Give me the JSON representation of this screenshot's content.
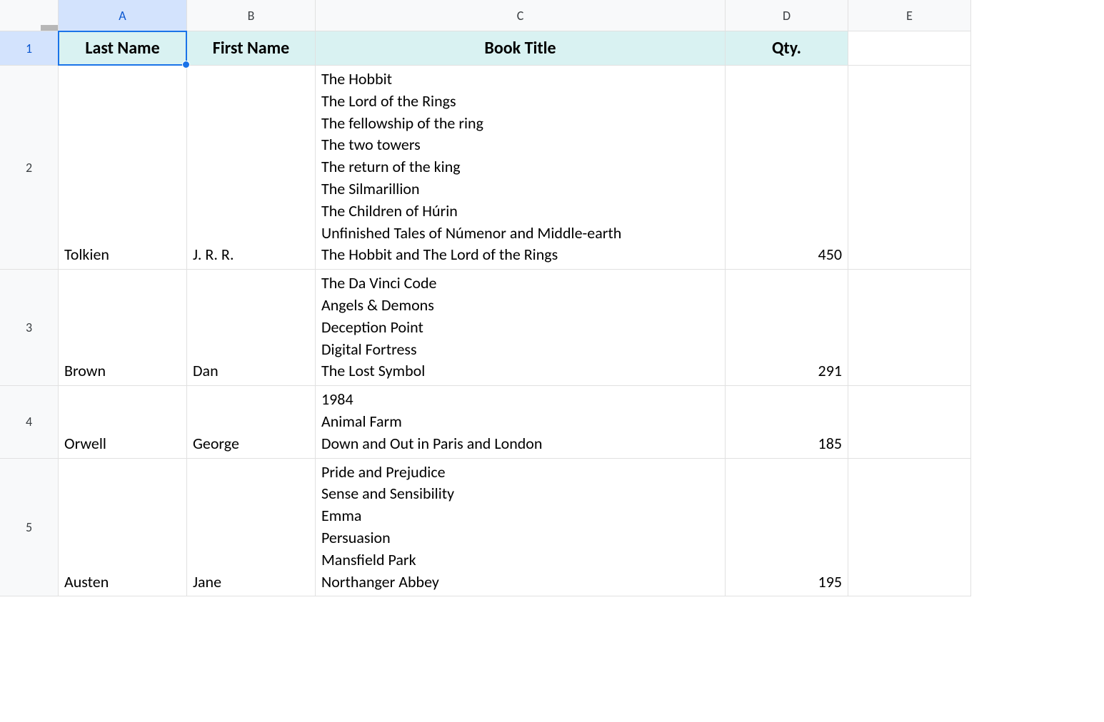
{
  "columns": [
    "A",
    "B",
    "C",
    "D",
    "E"
  ],
  "headers": {
    "last_name": "Last Name",
    "first_name": "First Name",
    "book_title": "Book Title",
    "qty": "Qty."
  },
  "rows": [
    {
      "num": "1"
    },
    {
      "num": "2",
      "last_name": "Tolkien",
      "first_name": "J. R. R.",
      "book_title": "The Hobbit\nThe Lord of the Rings\nThe fellowship of the ring\nThe two towers\nThe return of the king\nThe Silmarillion\nThe Children of Húrin\nUnfinished Tales of Númenor and Middle-earth\nThe Hobbit and The Lord of the Rings",
      "qty": "450"
    },
    {
      "num": "3",
      "last_name": "Brown",
      "first_name": "Dan",
      "book_title": "The Da Vinci Code\nAngels & Demons\nDeception Point\nDigital Fortress\nThe Lost Symbol",
      "qty": "291"
    },
    {
      "num": "4",
      "last_name": "Orwell",
      "first_name": "George",
      "book_title": "1984\nAnimal Farm\nDown and Out in Paris and London",
      "qty": "185"
    },
    {
      "num": "5",
      "last_name": "Austen",
      "first_name": "Jane",
      "book_title": "Pride and Prejudice\nSense and Sensibility\nEmma\nPersuasion\nMansfield Park\nNorthanger Abbey",
      "qty": "195"
    }
  ],
  "selected_cell": "A1"
}
